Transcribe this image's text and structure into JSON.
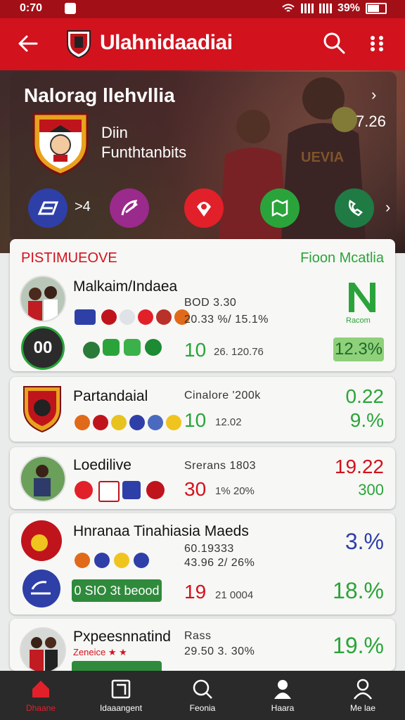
{
  "status_bar": {
    "time": "0:70",
    "battery": "39%"
  },
  "app_bar": {
    "title": "Ulahnidaadiai"
  },
  "hero": {
    "league_title": "Nalorag llehvllia",
    "subtitle_line1": "Diin",
    "subtitle_line2": "Funthtanbits",
    "score": "7.26",
    "quick_count": ">4"
  },
  "card1": {
    "left_label": "PISTIMUEOVE",
    "right_label": "Fioon Mcatlia",
    "name": "Malkaim/Indaea",
    "stat1": "BOD 3.30",
    "stat2": "20.33  %/ 15.1%",
    "badge": "00",
    "big_value": "10",
    "small_value": "26. 120.76",
    "logo_caption": "Racom",
    "pct": "12.3%"
  },
  "card2": {
    "name": "Partandaial",
    "stat": "Cinalore '200k",
    "big_value": "10",
    "small_value": "12.02",
    "pct1": "0.22",
    "pct2": "9.%"
  },
  "card3": {
    "name": "Loedilive",
    "stat": "Srerans 1803",
    "big_value": "30",
    "small_value": "1% 20%",
    "pct1": "19.22",
    "pct2": "300"
  },
  "card4": {
    "name": "Hnranaa Tinahiasia Maeds",
    "stat1": "60.19333",
    "stat2": "43.96  2/ 26%",
    "bar_text": "0 SIO 3t beood",
    "big_value": "19",
    "small_value": "21 0004",
    "pct1": "3.%",
    "pct2": "18.%"
  },
  "card5": {
    "name": "Pxpeesnnatind",
    "caption": "Zeneice ★ ★",
    "stat1": "Rass",
    "stat2": "29.50  3. 30%",
    "pct": "19.%"
  },
  "bottom_nav": [
    {
      "label": "Dhaane",
      "icon": "home-icon"
    },
    {
      "label": "Idaaangent",
      "icon": "document-icon"
    },
    {
      "label": "Feonia",
      "icon": "search-icon"
    },
    {
      "label": "Haara",
      "icon": "person-icon"
    },
    {
      "label": "Me lae",
      "icon": "profile-icon"
    }
  ],
  "colors": {
    "brand_red": "#d2121d",
    "green": "#2aa43a",
    "nav_bg": "#2a2a2a"
  }
}
